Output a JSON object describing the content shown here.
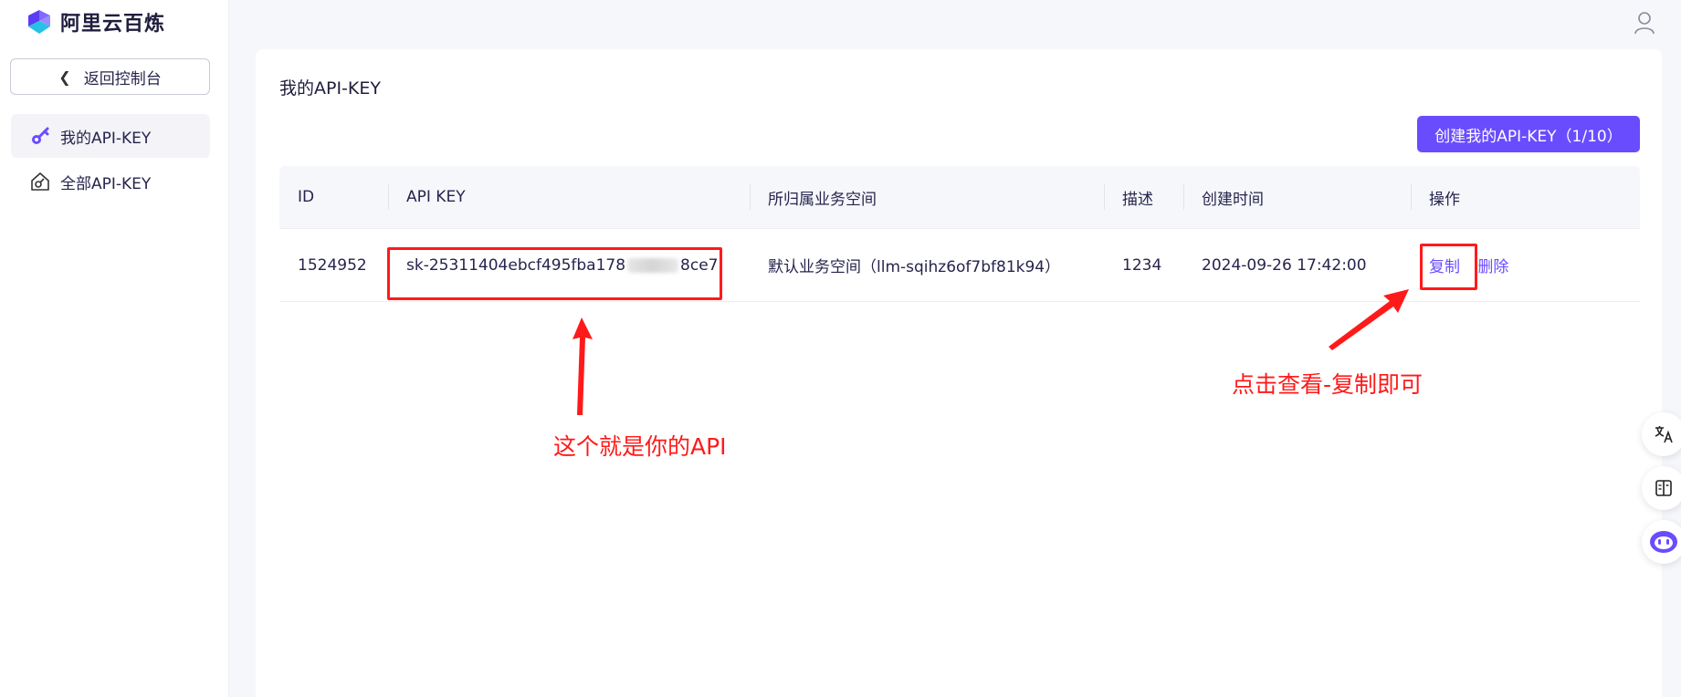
{
  "brand": {
    "name": "阿里云百炼"
  },
  "sidebar": {
    "back_label": "返回控制台",
    "items": [
      {
        "label": "我的API-KEY",
        "icon": "key-icon",
        "active": true
      },
      {
        "label": "全部API-KEY",
        "icon": "home-key-icon",
        "active": false
      }
    ]
  },
  "main": {
    "title": "我的API-KEY",
    "create_button": "创建我的API-KEY（1/10）",
    "table": {
      "headers": [
        "ID",
        "API KEY",
        "所归属业务空间",
        "描述",
        "创建时间",
        "操作"
      ],
      "rows": [
        {
          "id": "1524952",
          "api_key_start": "sk-25311404ebcf495fba178",
          "api_key_end": "8ce7",
          "workspace": "默认业务空间（llm-sqihz6of7bf81k94）",
          "description": "1234",
          "created": "2024-09-26 17:42:00",
          "action_copy": "复制",
          "action_delete": "删除"
        }
      ]
    }
  },
  "annotations": {
    "api_note": "这个就是你的API",
    "copy_note": "点击查看-复制即可"
  },
  "colors": {
    "accent": "#6a4cff",
    "annotation": "#ff1a1a"
  }
}
